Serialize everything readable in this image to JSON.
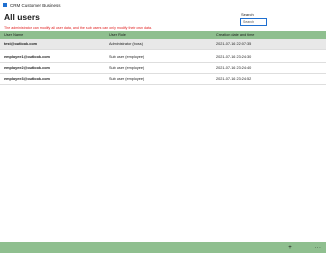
{
  "window": {
    "title": "CRM Customer Business"
  },
  "page": {
    "title": "All users",
    "notice": "The administrator can modify all user data, and the sub users can only modify their own data."
  },
  "search": {
    "label": "Search",
    "placeholder": "Search"
  },
  "table": {
    "columns": [
      "User Name",
      "User Role",
      "Creation date and time"
    ],
    "rows": [
      {
        "name": "test@outlook.com",
        "role": "Administrator (boss)",
        "created": "2021-07-16 22:07:35"
      },
      {
        "name": "employee1@outlook.com",
        "role": "Sub user (employee)",
        "created": "2021-07-16 23:24:30"
      },
      {
        "name": "employee2@outlook.com",
        "role": "Sub user (employee)",
        "created": "2021-07-16 23:24:40"
      },
      {
        "name": "employee3@outlook.com",
        "role": "Sub user (employee)",
        "created": "2021-07-16 23:24:52"
      }
    ]
  },
  "footer": {
    "add_icon": "+",
    "more_icon": "···"
  },
  "colors": {
    "accent": "#8fbf8f",
    "notice": "#e02020",
    "focus": "#1e6fd0"
  }
}
